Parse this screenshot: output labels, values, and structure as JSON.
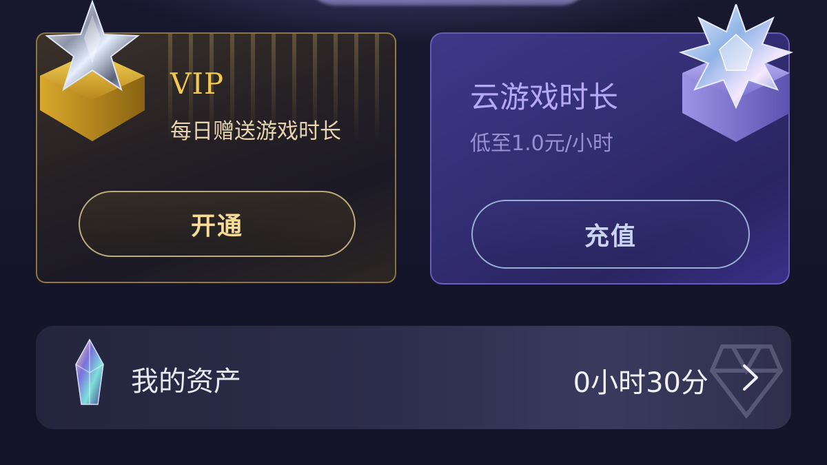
{
  "vip_card": {
    "title": "VIP",
    "subtitle": "每日赠送游戏时长",
    "button_label": "开通",
    "accent_color": "#f2c94c"
  },
  "cloud_card": {
    "title": "云游戏时长",
    "subtitle": "低至1.0元/小时",
    "button_label": "充值",
    "accent_color": "#b6a8f5"
  },
  "assets": {
    "label": "我的资产",
    "value": "0小时30分",
    "icon": "gem-icon",
    "chevron_icon": "chevron-right-icon"
  },
  "icons": {
    "vip_badge": "star-badge-icon",
    "cloud_badge": "crystal-badge-icon"
  }
}
